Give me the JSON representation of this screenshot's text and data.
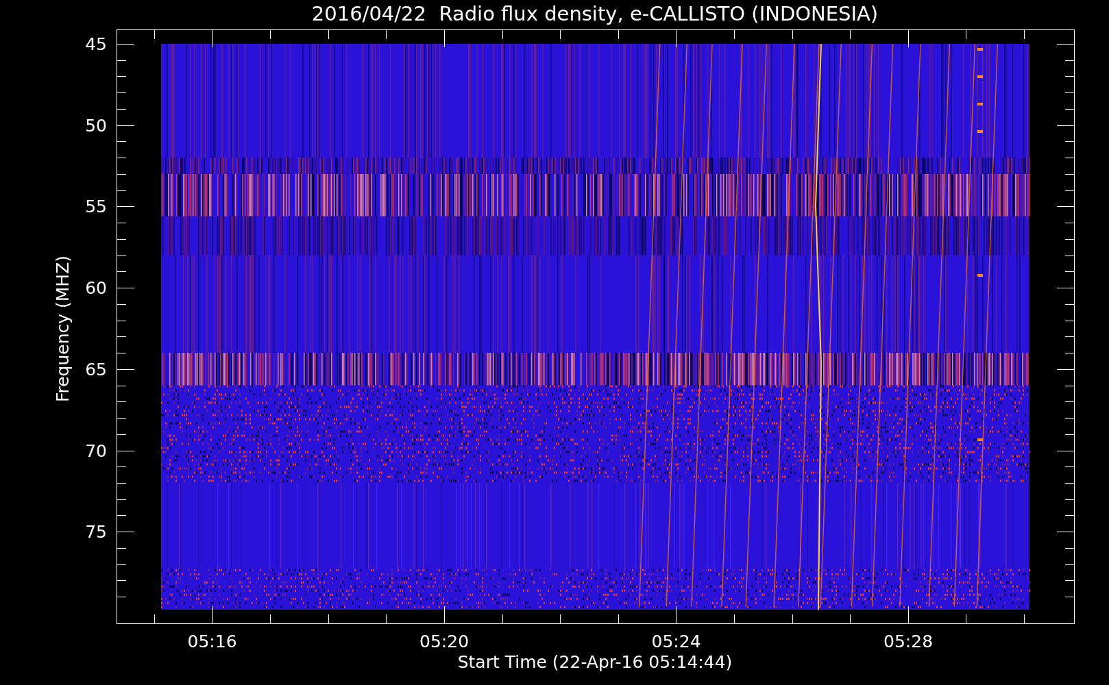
{
  "plot": {
    "title": "2016/04/22  Radio flux density, e-CALLISTO (INDONESIA)",
    "xlabel": "Start Time (22-Apr-16 05:14:44)",
    "ylabel": "Frequency (MHZ)",
    "xticks": [
      "05:16",
      "05:20",
      "05:24",
      "05:28"
    ],
    "yticks": [
      "45",
      "50",
      "55",
      "60",
      "65",
      "70",
      "75"
    ]
  }
}
